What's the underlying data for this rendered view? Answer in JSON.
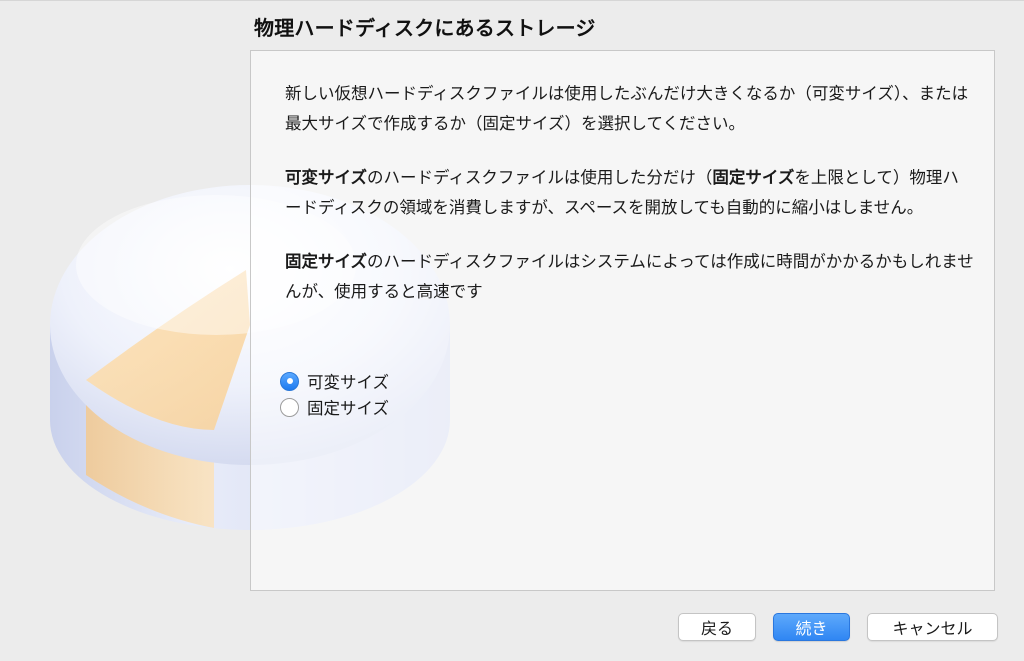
{
  "dialog": {
    "title": "物理ハードディスクにあるストレージ"
  },
  "description": {
    "intro": "新しい仮想ハードディスクファイルは使用したぶんだけ大きくなるか（可変サイズ）、または最大サイズで作成するか（固定サイズ）を選択してください。",
    "dynamic": {
      "term": "可変サイズ",
      "text_a": "のハードディスクファイルは使用した分だけ（",
      "term2": "固定サイズ",
      "text_b": "を上限として）物理ハードディスクの領域を消費しますが、スペースを開放しても自動的に縮小はしません。"
    },
    "fixed": {
      "term": "固定サイズ",
      "text": "のハードディスクファイルはシステムによっては作成に時間がかかるかもしれませんが、使用すると高速です"
    }
  },
  "options": [
    {
      "label": "可変サイズ",
      "selected": true
    },
    {
      "label": "固定サイズ",
      "selected": false
    }
  ],
  "buttons": {
    "back": "戻る",
    "continue": "続き",
    "cancel": "キャンセル"
  },
  "icons": {
    "background_art": "disk-storage-icon"
  },
  "colors": {
    "accent": "#2f86f3",
    "disk_slice": "#f7cf97",
    "disk_body": "#dfe4f5"
  }
}
